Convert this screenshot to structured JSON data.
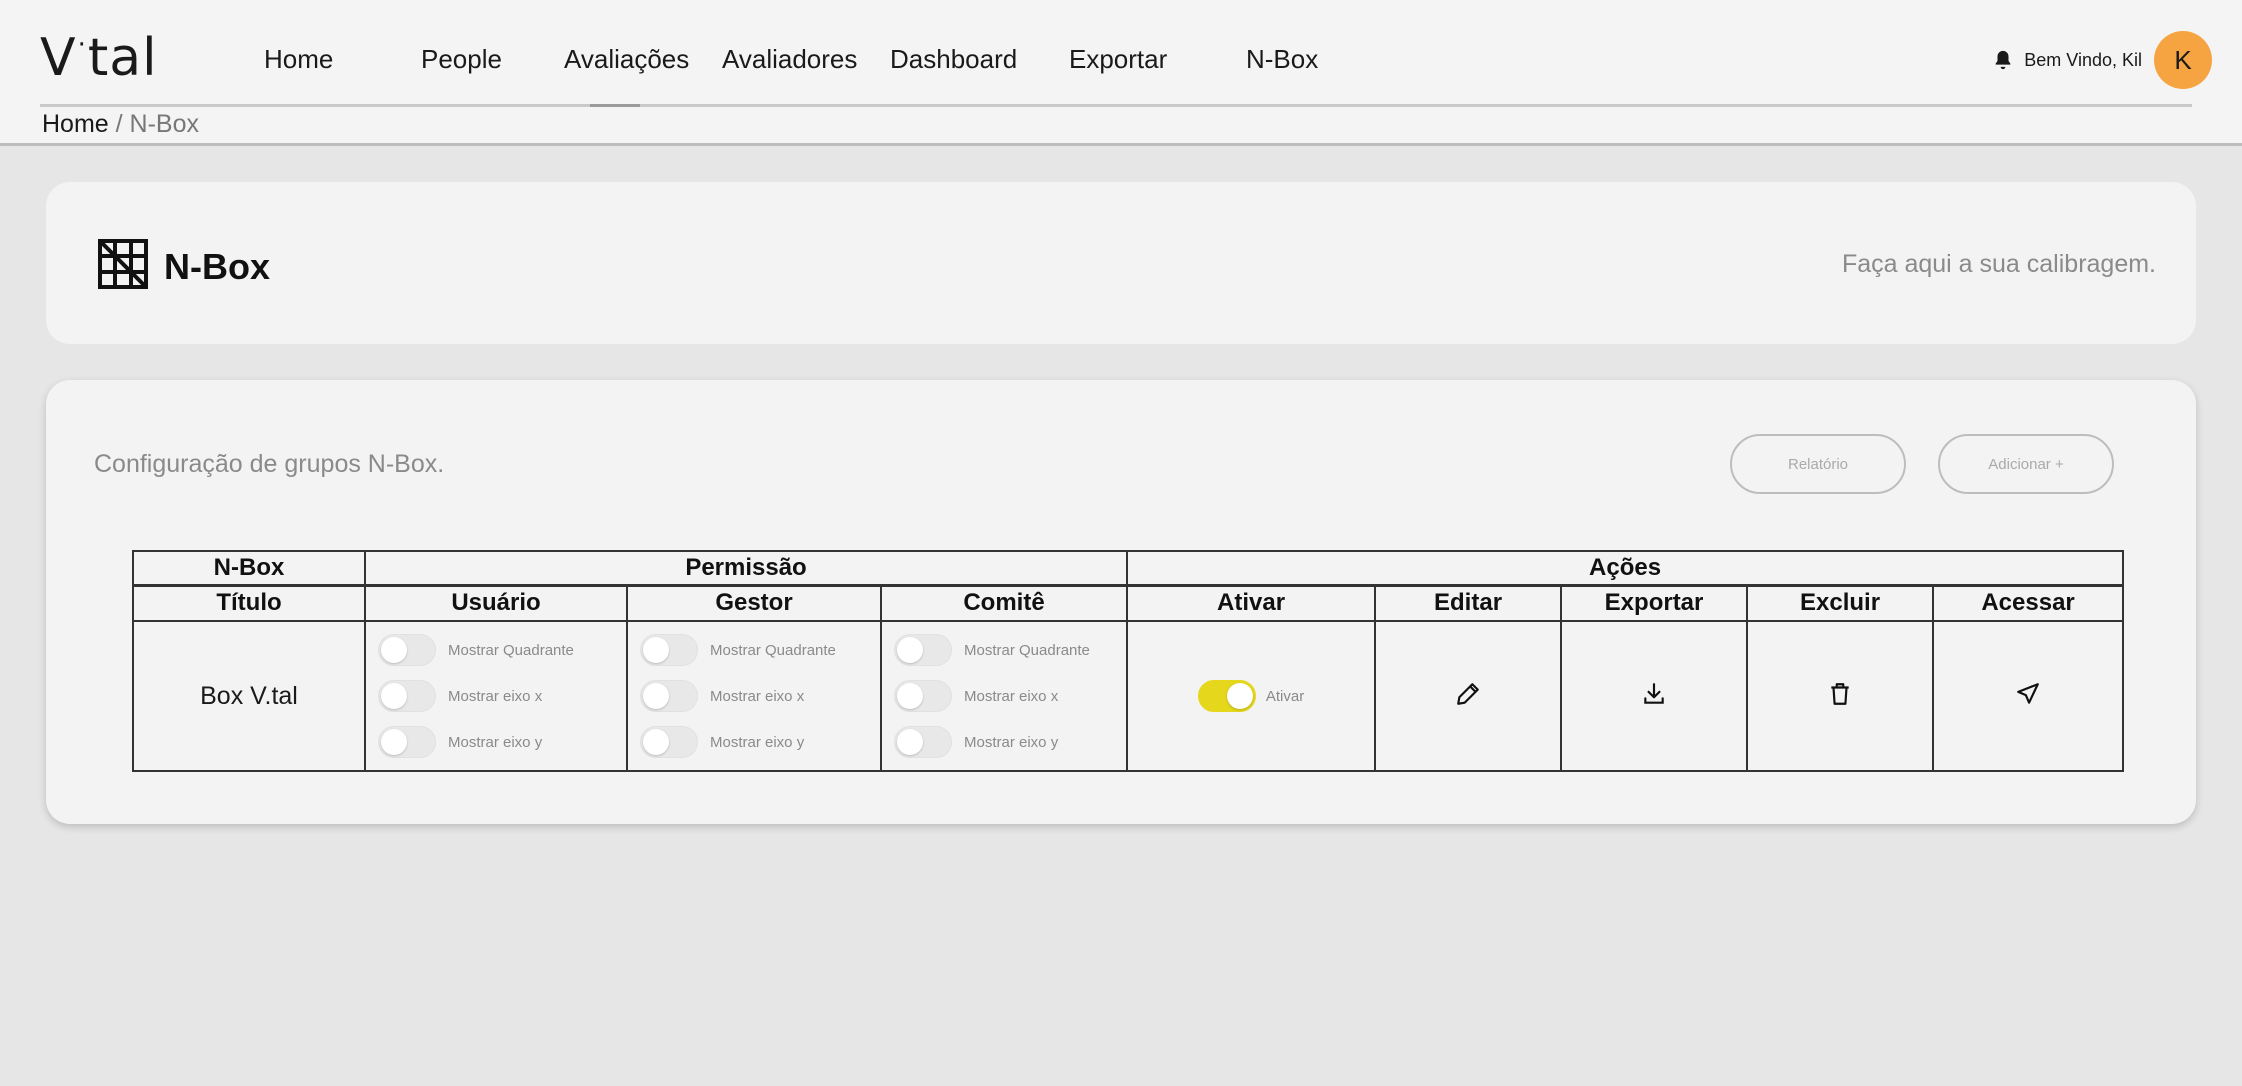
{
  "brand": {
    "logo_left": "V",
    "logo_dot": "·",
    "logo_right": "tal"
  },
  "nav": {
    "items": [
      {
        "label": "Home"
      },
      {
        "label": "People"
      },
      {
        "label": "Avaliações"
      },
      {
        "label": "Avaliadores"
      },
      {
        "label": "Dashboard"
      },
      {
        "label": "Exportar"
      },
      {
        "label": "N-Box"
      }
    ]
  },
  "user": {
    "welcome": "Bem Vindo, Kil",
    "avatar_initial": "K",
    "avatar_color": "#f6a341"
  },
  "breadcrumb": {
    "home": "Home",
    "separator": " / ",
    "current": "N-Box"
  },
  "page_header": {
    "title": "N-Box",
    "icon": "grid-box-icon",
    "subtitle": "Faça aqui a sua calibragem."
  },
  "config": {
    "label": "Configuração de grupos N-Box.",
    "report_button": "Relatório",
    "add_button": "Adicionar +"
  },
  "table": {
    "group_headers": {
      "nbox": "N-Box",
      "permissao": "Permissão",
      "acoes": "Ações"
    },
    "columns": {
      "titulo": "Título",
      "usuario": "Usuário",
      "gestor": "Gestor",
      "comite": "Comitê",
      "ativar": "Ativar",
      "editar": "Editar",
      "exportar": "Exportar",
      "excluir": "Excluir",
      "acessar": "Acessar"
    },
    "row": {
      "title": "Box V.tal",
      "toggle_labels": [
        "Mostrar Quadrante",
        "Mostrar eixo x",
        "Mostrar eixo y"
      ],
      "ativar_label": "Ativar",
      "ativar_on": true,
      "accent": "#e4d71c"
    }
  }
}
